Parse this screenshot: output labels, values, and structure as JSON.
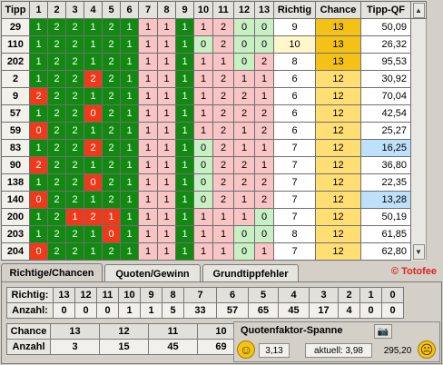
{
  "grid": {
    "headers": [
      "Tipp",
      "1",
      "2",
      "3",
      "4",
      "5",
      "6",
      "7",
      "8",
      "9",
      "10",
      "11",
      "12",
      "13",
      "Richtig",
      "Chance",
      "Tipp-QF"
    ],
    "rows": [
      {
        "tipp": "29",
        "v": [
          "1",
          "2",
          "2",
          "1",
          "2",
          "1",
          "1",
          "1",
          "1",
          "1",
          "2",
          "0",
          "0"
        ],
        "richtig": "9",
        "chance": "13",
        "qf": "50,09",
        "hl": true
      },
      {
        "tipp": "110",
        "v": [
          "1",
          "2",
          "2",
          "1",
          "2",
          "1",
          "1",
          "1",
          "1",
          "0",
          "2",
          "0",
          "0"
        ],
        "richtig": "10",
        "chance": "13",
        "qf": "26,32",
        "hl": true
      },
      {
        "tipp": "202",
        "v": [
          "1",
          "2",
          "2",
          "1",
          "2",
          "1",
          "1",
          "1",
          "1",
          "1",
          "1",
          "0",
          "2"
        ],
        "richtig": "8",
        "chance": "13",
        "qf": "95,53",
        "hl": true
      },
      {
        "tipp": "2",
        "v": [
          "1",
          "2",
          "2",
          "2",
          "2",
          "1",
          "1",
          "1",
          "1",
          "1",
          "2",
          "1",
          "1"
        ],
        "richtig": "6",
        "chance": "12",
        "qf": "30,92",
        "hl": false
      },
      {
        "tipp": "9",
        "v": [
          "2",
          "2",
          "2",
          "1",
          "2",
          "1",
          "1",
          "1",
          "1",
          "1",
          "2",
          "2",
          "1"
        ],
        "richtig": "6",
        "chance": "12",
        "qf": "70,04",
        "hl": false
      },
      {
        "tipp": "57",
        "v": [
          "1",
          "2",
          "2",
          "0",
          "2",
          "1",
          "1",
          "1",
          "1",
          "1",
          "2",
          "2",
          "2"
        ],
        "richtig": "6",
        "chance": "12",
        "qf": "42,54",
        "hl": false
      },
      {
        "tipp": "59",
        "v": [
          "0",
          "2",
          "2",
          "1",
          "2",
          "1",
          "1",
          "1",
          "1",
          "1",
          "2",
          "1",
          "2"
        ],
        "richtig": "6",
        "chance": "12",
        "qf": "25,27",
        "hl": false
      },
      {
        "tipp": "83",
        "v": [
          "1",
          "2",
          "2",
          "2",
          "2",
          "1",
          "1",
          "1",
          "1",
          "0",
          "2",
          "1",
          "1"
        ],
        "richtig": "7",
        "chance": "12",
        "qf": "16,25",
        "hl": false
      },
      {
        "tipp": "90",
        "v": [
          "2",
          "2",
          "2",
          "1",
          "2",
          "1",
          "1",
          "1",
          "1",
          "0",
          "2",
          "2",
          "1"
        ],
        "richtig": "7",
        "chance": "12",
        "qf": "36,80",
        "hl": false
      },
      {
        "tipp": "138",
        "v": [
          "1",
          "2",
          "2",
          "0",
          "2",
          "1",
          "1",
          "1",
          "1",
          "0",
          "2",
          "2",
          "2"
        ],
        "richtig": "7",
        "chance": "12",
        "qf": "22,35",
        "hl": false
      },
      {
        "tipp": "140",
        "v": [
          "0",
          "2",
          "2",
          "1",
          "2",
          "1",
          "1",
          "1",
          "1",
          "0",
          "2",
          "1",
          "2"
        ],
        "richtig": "7",
        "chance": "12",
        "qf": "13,28",
        "hl": false
      },
      {
        "tipp": "200",
        "v": [
          "1",
          "2",
          "1",
          "2",
          "1",
          "1",
          "1",
          "1",
          "1",
          "1",
          "1",
          "1",
          "0"
        ],
        "richtig": "7",
        "chance": "12",
        "qf": "50,19",
        "hl": false
      },
      {
        "tipp": "203",
        "v": [
          "1",
          "2",
          "2",
          "1",
          "0",
          "1",
          "1",
          "1",
          "1",
          "1",
          "1",
          "0",
          "0"
        ],
        "richtig": "8",
        "chance": "12",
        "qf": "61,85",
        "hl": false
      },
      {
        "tipp": "204",
        "v": [
          "0",
          "2",
          "2",
          "1",
          "2",
          "1",
          "1",
          "1",
          "1",
          "1",
          "1",
          "0",
          "1"
        ],
        "richtig": "7",
        "chance": "12",
        "qf": "62,80",
        "hl": false
      }
    ]
  },
  "colors": {
    "green": "#128a12",
    "red": "#ee3a1a",
    "pink": "#f8c4c4",
    "light_green": "#c9f0c5",
    "chance_13": "#f4c117",
    "chance_12": "#ffde74",
    "qf_highlight": "#bfe0fb",
    "brand": "#d22222"
  },
  "tabs": {
    "items": [
      "Richtige/Chancen",
      "Quoten/Gewinn",
      "Grundtippfehler"
    ],
    "active": "Richtige/Chancen"
  },
  "brand": "© Totofee",
  "scroll_up": "▲",
  "scroll_down": "▼",
  "richtig_table": {
    "label_top": "Richtig:",
    "label_bottom": "Anzahl:",
    "cols": [
      "13",
      "12",
      "11",
      "10",
      "9",
      "8",
      "7",
      "6",
      "5",
      "4",
      "3",
      "2",
      "1",
      "0"
    ],
    "counts": [
      "0",
      "0",
      "0",
      "1",
      "1",
      "5",
      "33",
      "57",
      "65",
      "45",
      "17",
      "4",
      "0",
      "0"
    ]
  },
  "chance_table": {
    "label_top": "Chance",
    "label_bottom": "Anzahl",
    "cols": [
      "13",
      "12",
      "11",
      "10"
    ],
    "counts": [
      "3",
      "15",
      "45",
      "69"
    ]
  },
  "quotenfaktor": {
    "title": "Quotenfaktor-Spanne",
    "min": "3,13",
    "current": "aktuell: 3,98",
    "max": "295,20",
    "happy_icon": "☺",
    "sad_icon": "☹",
    "camera_icon": "📷"
  }
}
